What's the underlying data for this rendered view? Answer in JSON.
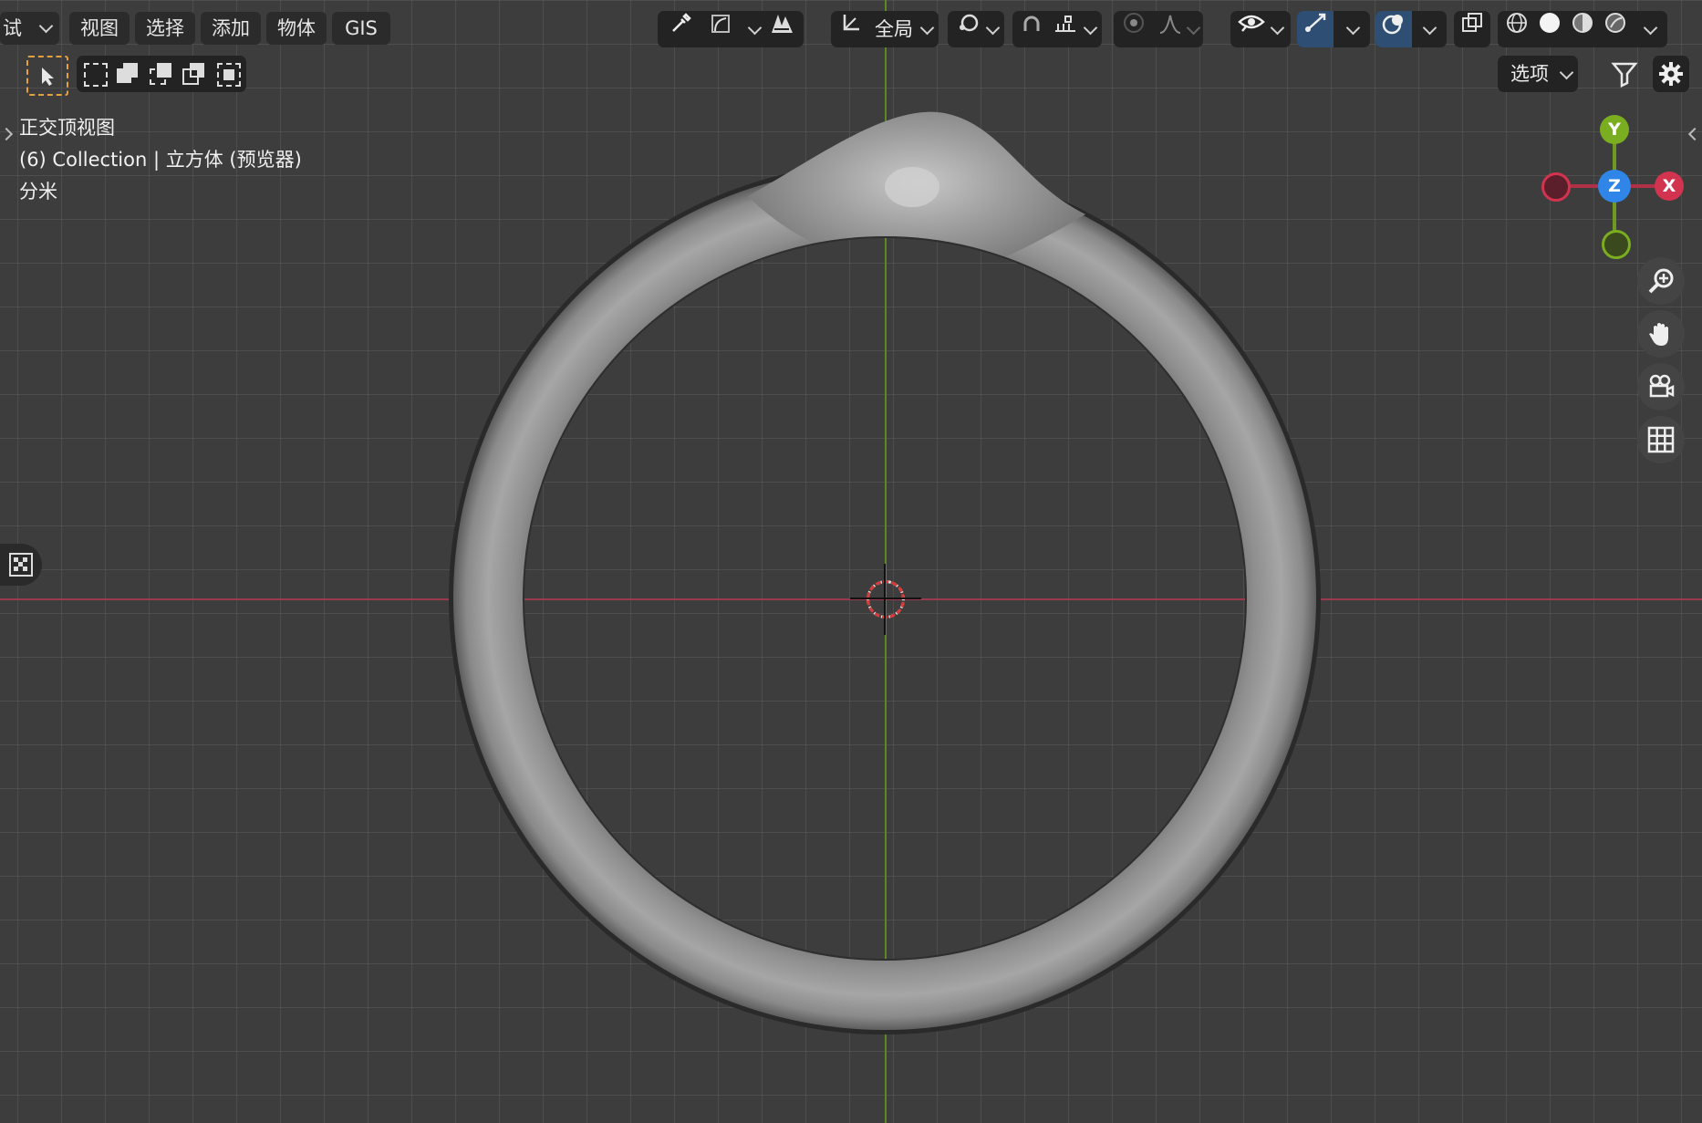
{
  "header": {
    "mode_label": "试",
    "menus": [
      "视图",
      "选择",
      "添加",
      "物体",
      "GIS"
    ],
    "transform_orientation": "全局",
    "options_label": "选项"
  },
  "overlay": {
    "view_name": "正交顶视图",
    "collection_info": "(6) Collection | 立方体 (预览器)",
    "units": "分米"
  },
  "gizmo": {
    "y_label": "Y",
    "z_label": "Z",
    "x_label": "X"
  },
  "colors": {
    "axis_x": "#d2344f",
    "axis_y": "#7aad1f",
    "axis_z": "#2f86e8",
    "active_blue": "#2e4f73",
    "background": "#3d3d3d"
  },
  "icons": {
    "tools": [
      "select-cursor-icon",
      "box-select-new-icon",
      "box-select-extend-icon",
      "box-select-subtract-icon",
      "box-select-invert-icon",
      "box-select-intersect-icon"
    ],
    "nav": [
      "zoom-icon",
      "pan-hand-icon",
      "camera-view-icon",
      "ortho-grid-icon"
    ]
  }
}
